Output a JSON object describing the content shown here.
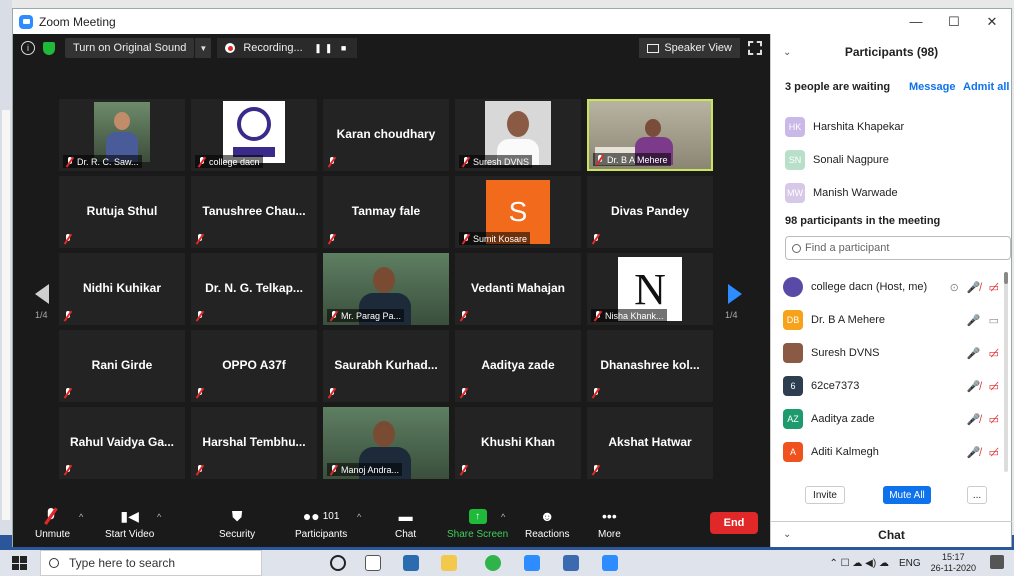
{
  "window": {
    "title": "Zoom Meeting"
  },
  "topbar": {
    "original_sound": "Turn on Original Sound",
    "recording": "Recording...",
    "speaker_view": "Speaker View"
  },
  "tiles": [
    {
      "name": "",
      "label": "Dr. R. C. Saw..."
    },
    {
      "name": "",
      "label": "college dacn"
    },
    {
      "name": "Karan choudhary",
      "label": ""
    },
    {
      "name": "",
      "label": "Suresh DVNS"
    },
    {
      "name": "",
      "label": "Dr. B A Mehere"
    },
    {
      "name": "Rutuja Sthul",
      "label": ""
    },
    {
      "name": "Tanushree Chau...",
      "label": ""
    },
    {
      "name": "Tanmay fale",
      "label": ""
    },
    {
      "name": "",
      "label": "Sumit Kosare"
    },
    {
      "name": "Divas Pandey",
      "label": ""
    },
    {
      "name": "Nidhi Kuhikar",
      "label": ""
    },
    {
      "name": "Dr. N. G. Telkap...",
      "label": ""
    },
    {
      "name": "",
      "label": "Mr. Parag Pa..."
    },
    {
      "name": "Vedanti Mahajan",
      "label": ""
    },
    {
      "name": "",
      "label": "Nisha Khank..."
    },
    {
      "name": "Rani Girde",
      "label": ""
    },
    {
      "name": "OPPO A37f",
      "label": ""
    },
    {
      "name": "Saurabh Kurhad...",
      "label": ""
    },
    {
      "name": "Aaditya zade",
      "label": ""
    },
    {
      "name": "Dhanashree kol...",
      "label": ""
    },
    {
      "name": "Rahul Vaidya Ga...",
      "label": ""
    },
    {
      "name": "Harshal Tembhu...",
      "label": ""
    },
    {
      "name": "",
      "label": "Manoj Andra..."
    },
    {
      "name": "Khushi Khan",
      "label": ""
    },
    {
      "name": "Akshat Hatwar",
      "label": ""
    }
  ],
  "tile_s_letter": "S",
  "tile_n_letter": "N",
  "paging": {
    "left": "1/4",
    "right": "1/4"
  },
  "toolbar": {
    "unmute": "Unmute",
    "start_video": "Start Video",
    "security": "Security",
    "participants": "Participants",
    "participants_count": "101",
    "chat": "Chat",
    "share_screen": "Share Screen",
    "reactions": "Reactions",
    "more": "More",
    "end": "End"
  },
  "panel": {
    "title": "Participants (98)",
    "waiting_text": "3 people are waiting",
    "message": "Message",
    "admit_all": "Admit all",
    "waiting": [
      {
        "initials": "HK",
        "name": "Harshita Khapekar",
        "color": "#c9b8e8"
      },
      {
        "initials": "SN",
        "name": "Sonali Nagpure",
        "color": "#b8e0c8"
      },
      {
        "initials": "MW",
        "name": "Manish Warwade",
        "color": "#d8c8e8"
      }
    ],
    "in_meeting": "98 participants in the meeting",
    "find_placeholder": "Find a participant",
    "participants": [
      {
        "initials": "",
        "name": "college dacn (Host, me)",
        "color": "#5a4aa8"
      },
      {
        "initials": "DB",
        "name": "Dr. B A Mehere",
        "color": "#f7a21b"
      },
      {
        "initials": "",
        "name": "Suresh DVNS",
        "color": "#8b5a44"
      },
      {
        "initials": "6",
        "name": "62ce7373",
        "color": "#2c3e50"
      },
      {
        "initials": "AZ",
        "name": "Aaditya zade",
        "color": "#1e9b6e"
      },
      {
        "initials": "A",
        "name": "Aditi Kalmegh",
        "color": "#f0521e"
      }
    ],
    "invite": "Invite",
    "mute_all": "Mute All",
    "more": "...",
    "chat": "Chat"
  },
  "taskbar": {
    "search": "Type here to search",
    "lang": "ENG",
    "time": "15:17",
    "date": "26-11-2020"
  },
  "colors": {
    "accent": "#2d8cff",
    "end": "#e02828",
    "green": "#1fba3a"
  }
}
